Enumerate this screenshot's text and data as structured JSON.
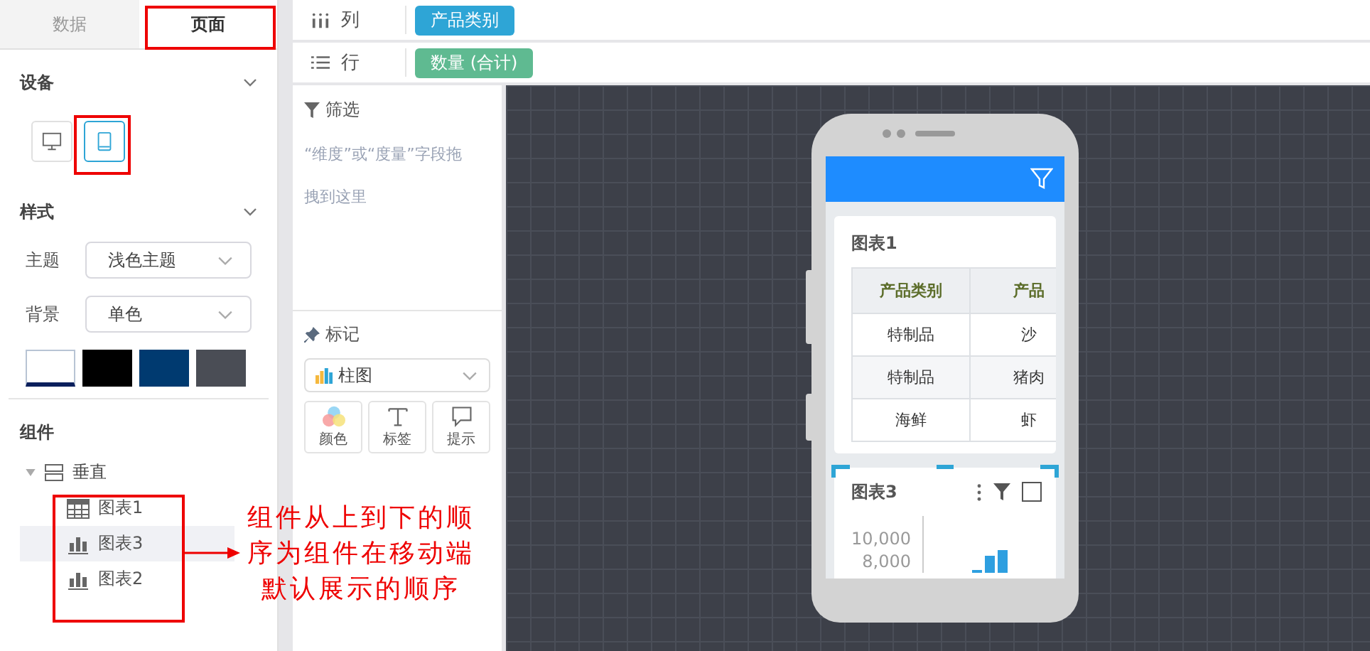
{
  "tabs": [
    {
      "label": "数据",
      "selected": false
    },
    {
      "label": "页面",
      "selected": true
    }
  ],
  "device": {
    "title": "设备",
    "expanded": true,
    "options": [
      {
        "kind": "desktop",
        "selected": false
      },
      {
        "kind": "tablet",
        "selected": true
      }
    ]
  },
  "style": {
    "title": "样式",
    "expanded": true,
    "fields": [
      {
        "label": "主题",
        "value": "浅色主题"
      },
      {
        "label": "背景",
        "value": "单色"
      }
    ],
    "swatches": [
      {
        "color": "#ffffff",
        "selected": true
      },
      {
        "color": "#000000",
        "selected": false
      },
      {
        "color": "#003a70",
        "selected": false
      },
      {
        "color": "#4a4d55",
        "selected": false
      }
    ]
  },
  "components": {
    "title": "组件",
    "tree": [
      {
        "label": "垂直",
        "kind": "vertical",
        "expanded": true,
        "children": [
          {
            "label": "图表1",
            "kind": "table",
            "selected": false
          },
          {
            "label": "图表3",
            "kind": "bar",
            "selected": true
          },
          {
            "label": "图表2",
            "kind": "bar",
            "selected": false
          }
        ]
      }
    ]
  },
  "shelves": [
    {
      "label": "列",
      "kind": "columns",
      "pill": "产品类别",
      "color": "#2ea5d6"
    },
    {
      "label": "行",
      "kind": "rows",
      "pill": "数量 (合计)",
      "color": "#5fba91"
    }
  ],
  "filter": {
    "title": "筛选",
    "hint": "“维度”或“度量”字段拖拽到这里"
  },
  "marks": {
    "title": "标记",
    "type": "柱图",
    "buttons": [
      {
        "kind": "color",
        "label": "颜色"
      },
      {
        "kind": "text",
        "label": "标签"
      },
      {
        "kind": "tooltip",
        "label": "提示"
      }
    ]
  },
  "phone": {
    "cards": [
      {
        "title": "图表1",
        "kind": "table",
        "selected": false,
        "columns": [
          "产品类别",
          "产品"
        ],
        "rows": [
          [
            "特制品",
            "沙"
          ],
          [
            "特制品",
            "猪肉"
          ],
          [
            "海鲜",
            "虾"
          ]
        ]
      },
      {
        "title": "图表3",
        "kind": "bar",
        "selected": true,
        "yticks": [
          "10,000",
          "8,000"
        ]
      }
    ]
  },
  "annotation": {
    "text": "组件从上到下的顺序为组件在移动端默认展示的顺序"
  }
}
